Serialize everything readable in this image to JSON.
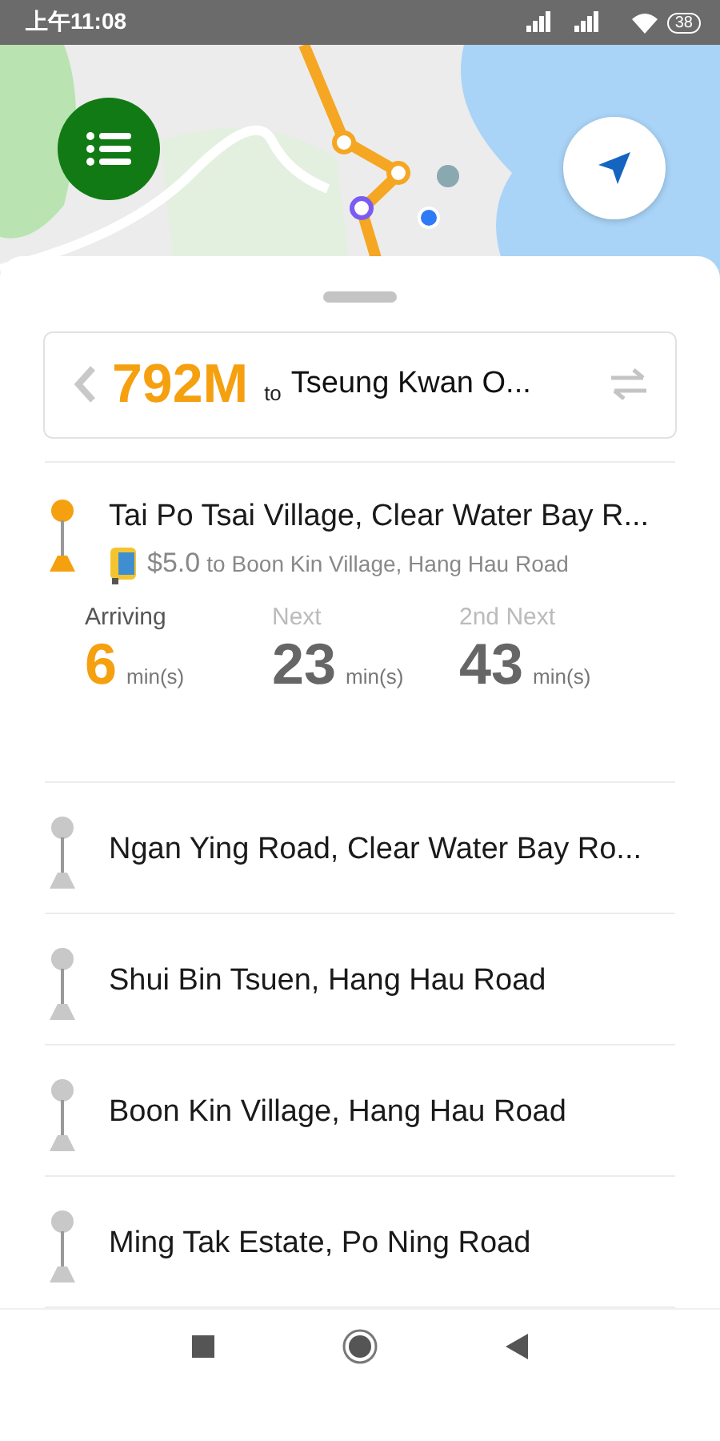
{
  "status_bar": {
    "time": "上午11:08",
    "battery": "38"
  },
  "route_header": {
    "distance": "792M",
    "connector": "to",
    "destination": "Tseung Kwan O..."
  },
  "stops": [
    {
      "name": "Tai Po Tsai Village, Clear Water Bay R...",
      "selected": true,
      "fare": "$5.0",
      "fare_connector": "to",
      "fare_destination": "Boon Kin Village, Hang Hau Road",
      "etas": [
        {
          "label": "Arriving",
          "value": "6",
          "unit": "min(s)",
          "selected": true
        },
        {
          "label": "Next",
          "value": "23",
          "unit": "min(s)",
          "selected": false
        },
        {
          "label": "2nd Next",
          "value": "43",
          "unit": "min(s)",
          "selected": false
        }
      ]
    },
    {
      "name": "Ngan Ying Road, Clear Water Bay Ro...",
      "selected": false
    },
    {
      "name": "Shui Bin Tsuen, Hang Hau Road",
      "selected": false
    },
    {
      "name": "Boon Kin Village, Hang Hau Road",
      "selected": false
    },
    {
      "name": "Ming Tak Estate, Po Ning Road",
      "selected": false
    }
  ]
}
